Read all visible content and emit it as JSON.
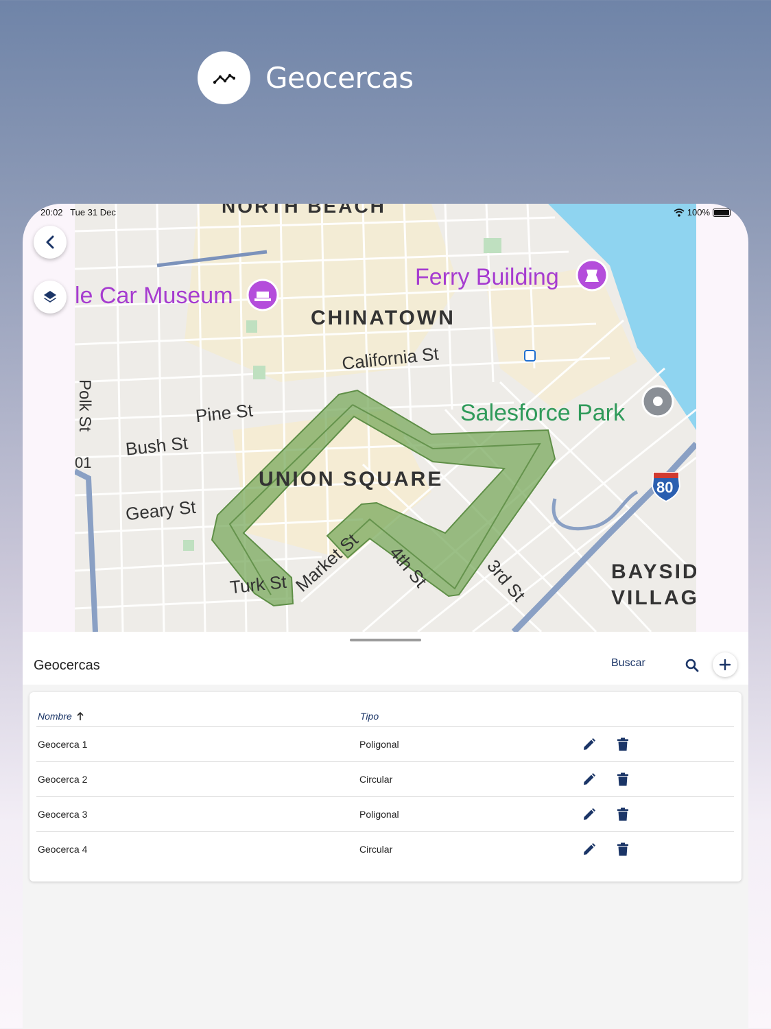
{
  "header": {
    "title": "Geocercas",
    "icon": "trend-line-icon"
  },
  "statusbar": {
    "time": "20:02",
    "date": "Tue 31 Dec",
    "battery": "100%"
  },
  "map": {
    "labels": {
      "north_beach": "NORTH BEACH",
      "car_museum": "le Car Museum",
      "ferry_building": "Ferry Building",
      "chinatown": "CHINATOWN",
      "california_st": "California St",
      "polk_st": "Polk St",
      "pine_st": "Pine St",
      "bush_st": "Bush St",
      "salesforce_park": "Salesforce Park",
      "union_square": "UNION SQUARE",
      "geary_st": "Geary St",
      "market_st": "Market St",
      "turk_st": "Turk St",
      "fourth_st": "4th St",
      "third_st": "3rd St",
      "bayside": "BAYSID",
      "village": "VILLAG",
      "i80": "80",
      "route_101": "01"
    },
    "colors": {
      "geofence_fill": "#7aaa5e",
      "geofence_stroke": "#5f8f47",
      "water": "#8fd4f0",
      "poi": "#b44ddb",
      "park_label": "#2f9a5a"
    }
  },
  "sheet": {
    "title": "Geocercas",
    "search_label": "Buscar",
    "columns": {
      "name": "Nombre",
      "type": "Tipo"
    },
    "rows": [
      {
        "name": "Geocerca 1",
        "type": "Poligonal"
      },
      {
        "name": "Geocerca 2",
        "type": "Circular"
      },
      {
        "name": "Geocerca 3",
        "type": "Poligonal"
      },
      {
        "name": "Geocerca 4",
        "type": "Circular"
      }
    ],
    "accent": "#1b3567"
  }
}
